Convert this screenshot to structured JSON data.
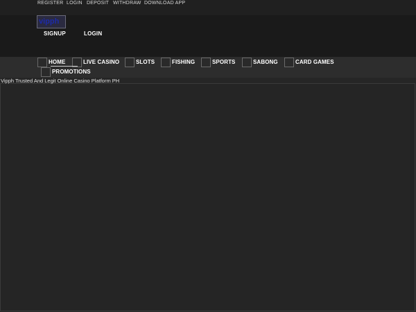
{
  "topbar": {
    "links": [
      "REGISTER",
      "LOGIN",
      "DEPOSIT",
      "WITHDRAW",
      "DOWNLOAD APP"
    ]
  },
  "header": {
    "logo_text": "vipph",
    "signup_label": "SIGNUP",
    "login_label": "LOGIN"
  },
  "nav": {
    "items": [
      "HOME",
      "LIVE CASINO",
      "SLOTS",
      "FISHING",
      "SPORTS",
      "SABONG",
      "CARD GAMES",
      "PROMOTIONS"
    ]
  },
  "main": {
    "caption": "Vipph Trusted And Legit Online Casino Platform PH"
  }
}
